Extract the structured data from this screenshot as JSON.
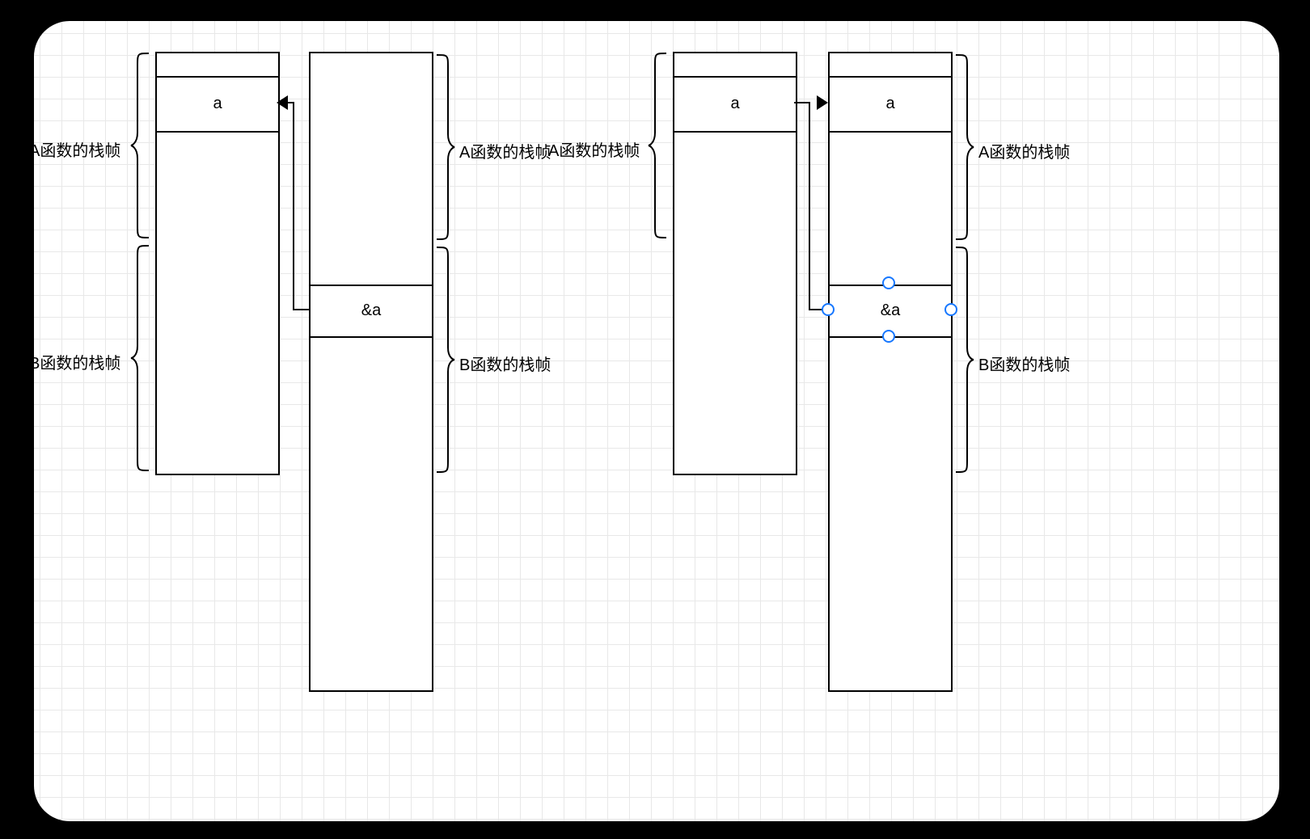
{
  "left_group": {
    "col1": {
      "brace_a_label": "A函数的栈帧",
      "brace_b_label": "B函数的栈帧",
      "cell_a": "a"
    },
    "col2": {
      "brace_a_label": "A函数的栈帧",
      "brace_b_label": "B函数的栈帧",
      "cell_ptr": "&a"
    }
  },
  "right_group": {
    "col1": {
      "brace_a_label": "A函数的栈帧",
      "cell_a": "a"
    },
    "col2": {
      "brace_a_label": "A函数的栈帧",
      "brace_b_label": "B函数的栈帧",
      "cell_a": "a",
      "cell_ptr": "&a"
    }
  },
  "colors": {
    "selection": "#1677ff"
  }
}
